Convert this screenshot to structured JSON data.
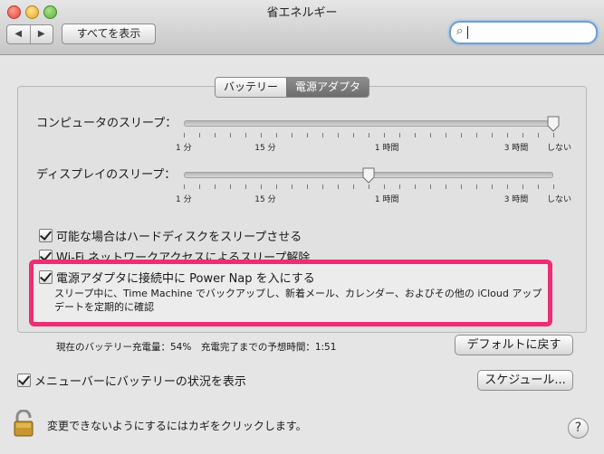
{
  "window": {
    "title": "省エネルギー"
  },
  "toolbar": {
    "back": "◀",
    "forward": "▶",
    "show_all": "すべてを表示",
    "search_value": ""
  },
  "tabs": [
    {
      "label": "バッテリー"
    },
    {
      "label": "電源アダプタ"
    }
  ],
  "computer_sleep": {
    "label": "コンピュータのスリープ：",
    "value_label": "しない",
    "ticks": [
      "1 分",
      "15 分",
      "1 時間",
      "3 時間",
      "しない"
    ],
    "position": 1.0
  },
  "display_sleep": {
    "label": "ディスプレイのスリープ：",
    "value_label": "",
    "ticks": [
      "1 分",
      "15 分",
      "1 時間",
      "3 時間",
      "しない"
    ],
    "position": 0.5
  },
  "options": [
    {
      "label": "可能な場合はハードディスクをスリープさせる",
      "checked": true
    },
    {
      "label": "Wi-Fi ネットワークアクセスによるスリープ解除",
      "checked": true
    },
    {
      "label": "電源アダプタに接続中に Power Nap を入にする",
      "checked": true,
      "description": "スリープ中に、Time Machine でバックアップし、新着メール、カレンダー、およびその他の iCloud アップデートを定期的に確認"
    }
  ],
  "status": {
    "battery": "現在のバッテリー充電量：54%　充電完了までの予想時間：1:51"
  },
  "buttons": {
    "defaults": "デフォルトに戻す",
    "schedule": "スケジュール..."
  },
  "menubar_option": {
    "label": "メニューバーにバッテリーの状況を表示",
    "checked": true
  },
  "lock": {
    "text": "変更できないようにするにはカギをクリックします。"
  },
  "help": {
    "label": "?"
  }
}
